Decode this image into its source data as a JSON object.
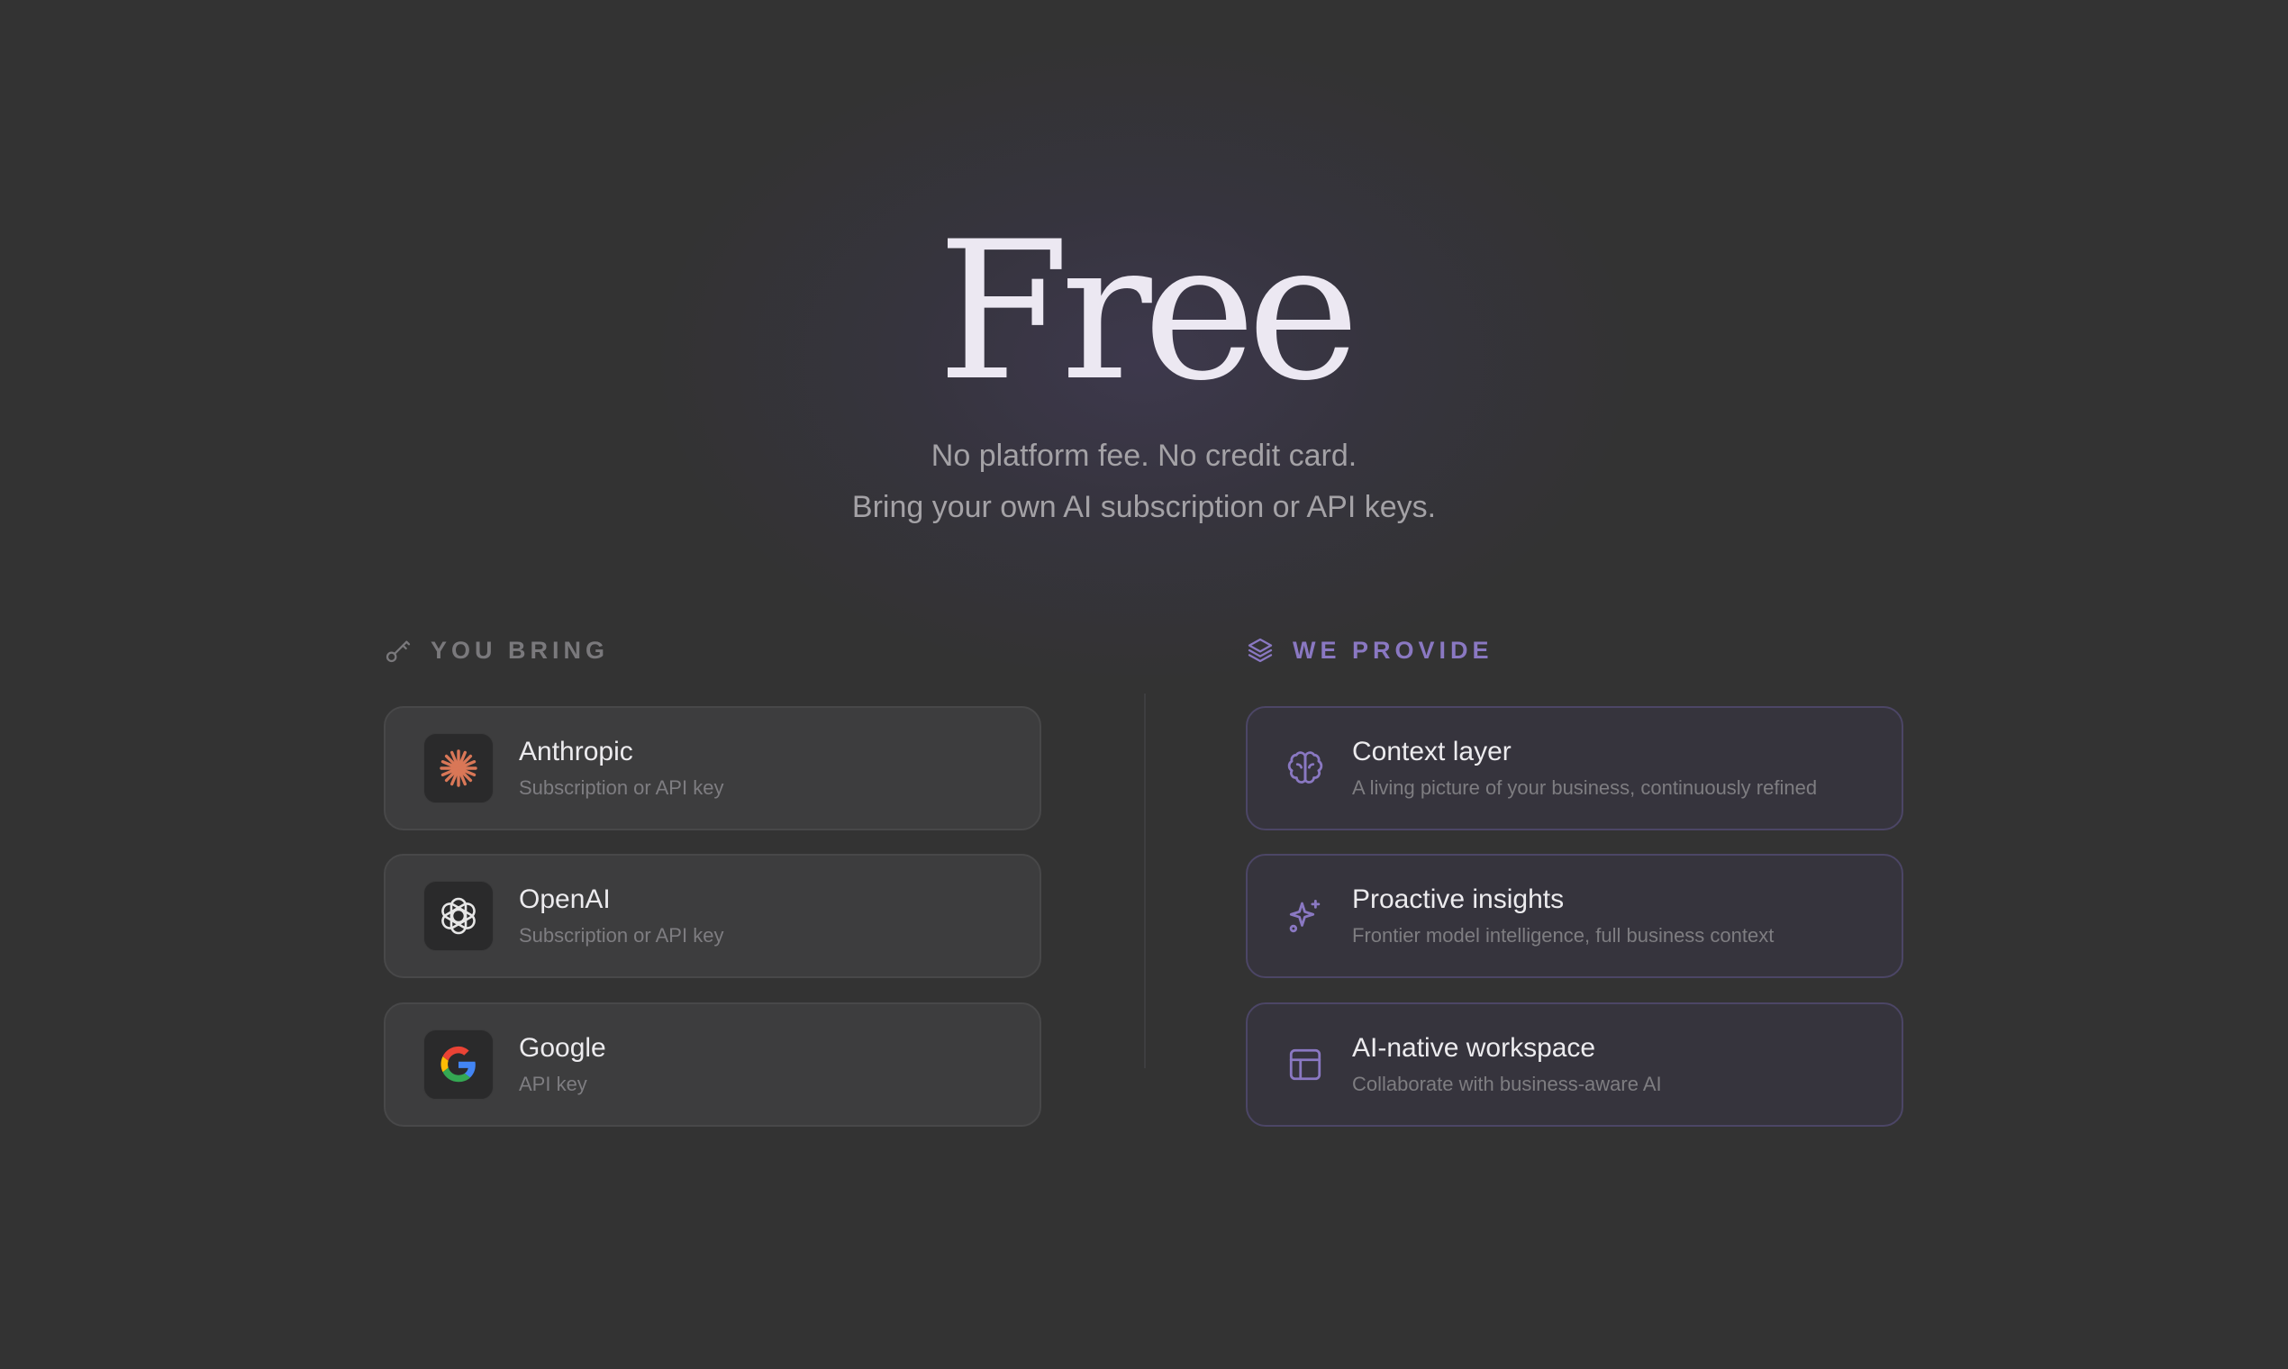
{
  "hero": {
    "title": "Free",
    "line1": "No platform fee. No credit card.",
    "line2": "Bring your own AI subscription or API keys."
  },
  "you_bring": {
    "heading": "YOU BRING",
    "icon": "key-icon",
    "heading_color": "#7a797c",
    "items": [
      {
        "title": "Anthropic",
        "subtitle": "Subscription or API key",
        "icon": "anthropic-logo-icon",
        "color": "#d97757"
      },
      {
        "title": "OpenAI",
        "subtitle": "Subscription or API key",
        "icon": "openai-logo-icon",
        "color": "#e6e6e6"
      },
      {
        "title": "Google",
        "subtitle": "API key",
        "icon": "google-logo-icon",
        "colors": [
          "#4285f4",
          "#34a853",
          "#fbbc05",
          "#ea4335"
        ]
      }
    ]
  },
  "we_provide": {
    "heading": "WE PROVIDE",
    "icon": "layers-icon",
    "heading_color": "#8a78c2",
    "items": [
      {
        "title": "Context layer",
        "subtitle": "A living picture of your business, continuously refined",
        "icon": "brain-icon"
      },
      {
        "title": "Proactive insights",
        "subtitle": "Frontier model intelligence, full business context",
        "icon": "sparkles-icon"
      },
      {
        "title": "AI-native workspace",
        "subtitle": "Collaborate with business-aware AI",
        "icon": "layout-icon"
      }
    ]
  },
  "colors": {
    "background": "#333333",
    "accent": "#8a78c2",
    "title": "#ece8f2"
  }
}
